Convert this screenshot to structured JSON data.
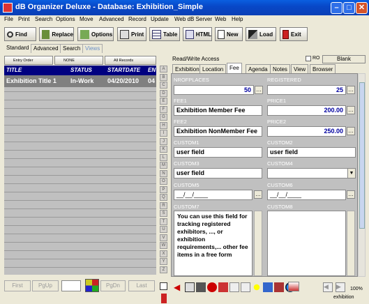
{
  "window": {
    "title": "dB Organizer Deluxe - Database: Exhibition_Simple"
  },
  "menu": [
    "File",
    "Print",
    "Search",
    "Options",
    "Move",
    "Advanced",
    "Record",
    "Update",
    "Web dB Server",
    "Web",
    "Help"
  ],
  "toolbar": {
    "find": "Find",
    "replace": "Replace",
    "options": "Options",
    "print": "Print",
    "table": "Table",
    "html": "HTML",
    "new": "New",
    "load": "Load",
    "exit": "Exit"
  },
  "left_tabs": [
    "Standard",
    "Advanced",
    "Search",
    "Views"
  ],
  "sort_buttons": {
    "entry_order": "Entry Order",
    "none": "NONE",
    "all_records": "All Records"
  },
  "grid": {
    "headers": [
      "TITLE",
      "STATUS",
      "STARTDATE",
      "EN"
    ],
    "rows": [
      {
        "title": "Exhibition Title 1",
        "status": "In-Work",
        "startdate": "04/20/2010",
        "en": "04"
      }
    ]
  },
  "nav": {
    "first": "First",
    "pgup": "PgUp",
    "pgdn": "PgDn",
    "last": "Last"
  },
  "alphabet": [
    "A",
    "B",
    "C",
    "D",
    "E",
    "F",
    "G",
    "H",
    "I",
    "J",
    "K",
    "L",
    "M",
    "N",
    "O",
    "P",
    "Q",
    "R",
    "S",
    "T",
    "U",
    "V",
    "W",
    "X",
    "Y",
    "Z"
  ],
  "record_panel": {
    "mode_label": "Read/Write Access",
    "ro_label": "RO",
    "blank_label": "Blank",
    "tabs": [
      "Exhibition",
      "Location",
      "Fee",
      "Agenda",
      "Notes",
      "View",
      "Browser"
    ],
    "active_tab": "Fee",
    "fields": {
      "nrofplaces": {
        "label": "NROFPLACES",
        "value": "50"
      },
      "registered": {
        "label": "REGISTERED",
        "value": "25"
      },
      "fee1": {
        "label": "FEE1",
        "value": "Exhibition Member Fee"
      },
      "price1": {
        "label": "PRICE1",
        "value": "200.00"
      },
      "fee2": {
        "label": "FEE2",
        "value": "Exhibition NonMember Fee"
      },
      "price2": {
        "label": "PRICE2",
        "value": "250.00"
      },
      "custom1": {
        "label": "CUSTOM1",
        "value": "user field"
      },
      "custom2": {
        "label": "CUSTOM2",
        "value": "user field"
      },
      "custom3": {
        "label": "CUSTOM3",
        "value": "user field"
      },
      "custom4": {
        "label": "CUSTOM4",
        "value": ""
      },
      "custom5": {
        "label": "CUSTOM5",
        "value": "__/__/____"
      },
      "custom6": {
        "label": "CUSTOM6",
        "value": "__/__/____"
      },
      "custom7": {
        "label": "CUSTOM7",
        "value": "You can use this field for tracking registered exhibitors, ..., or exhibition requirements,... other fee items in a free form"
      },
      "custom8": {
        "label": "CUSTOM8",
        "value": ""
      }
    }
  },
  "status": {
    "zoom": "100%",
    "table": "exhibition"
  },
  "colors": {
    "title_bar": "#0a4fd0",
    "grid_header": "#000080",
    "panel_bg": "#c0c0c0",
    "value_text": "#0000a0"
  }
}
